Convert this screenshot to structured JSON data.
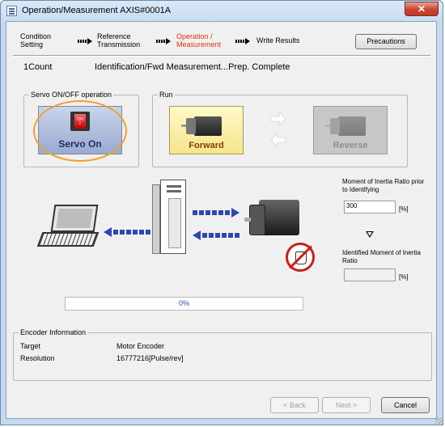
{
  "window": {
    "title": "Operation/Measurement AXIS#0001A",
    "close_glyph": "✕",
    "icon": "app-window-icon"
  },
  "steps": [
    {
      "label": "Condition Setting",
      "active": false
    },
    {
      "label": "Reference Transmission",
      "active": false
    },
    {
      "label": "Operation / Measurement",
      "active": true
    },
    {
      "label": "Write Results",
      "active": false
    }
  ],
  "colors": {
    "active_step": "#e03010",
    "progress_text": "#2b49b0",
    "arrow_blue": "#2f46b2",
    "highlight_ring": "#f0a030",
    "forward_bg": "#f5e58a"
  },
  "precautions_label": "Precautions",
  "status": {
    "count": "1Count",
    "message": "Identification/Fwd Measurement...Prep. Complete"
  },
  "servo_group": {
    "label": "Servo ON/OFF operation",
    "switch_on": "ON",
    "switch_off": "I",
    "button_label": "Servo On"
  },
  "run_group": {
    "label": "Run",
    "forward_label": "Forward",
    "reverse_label": "Reverse"
  },
  "inertia": {
    "prior_label": "Moment of Inertia Ratio prior to Identifying",
    "prior_value": "300",
    "prior_unit": "[%]",
    "identified_label": "Identified Moment of Inertia Ratio",
    "identified_value": "",
    "identified_unit": "[%]"
  },
  "progress": {
    "percent": 0,
    "text": "0%"
  },
  "encoder": {
    "group_label": "Encoder Information",
    "target_label": "Target",
    "target_value": "Motor Encoder",
    "resolution_label": "Resolution",
    "resolution_value": "16777216[Pulse/rev]"
  },
  "footer": {
    "back_label": "< Back",
    "next_label": "Next >",
    "cancel_label": "Cancel"
  }
}
